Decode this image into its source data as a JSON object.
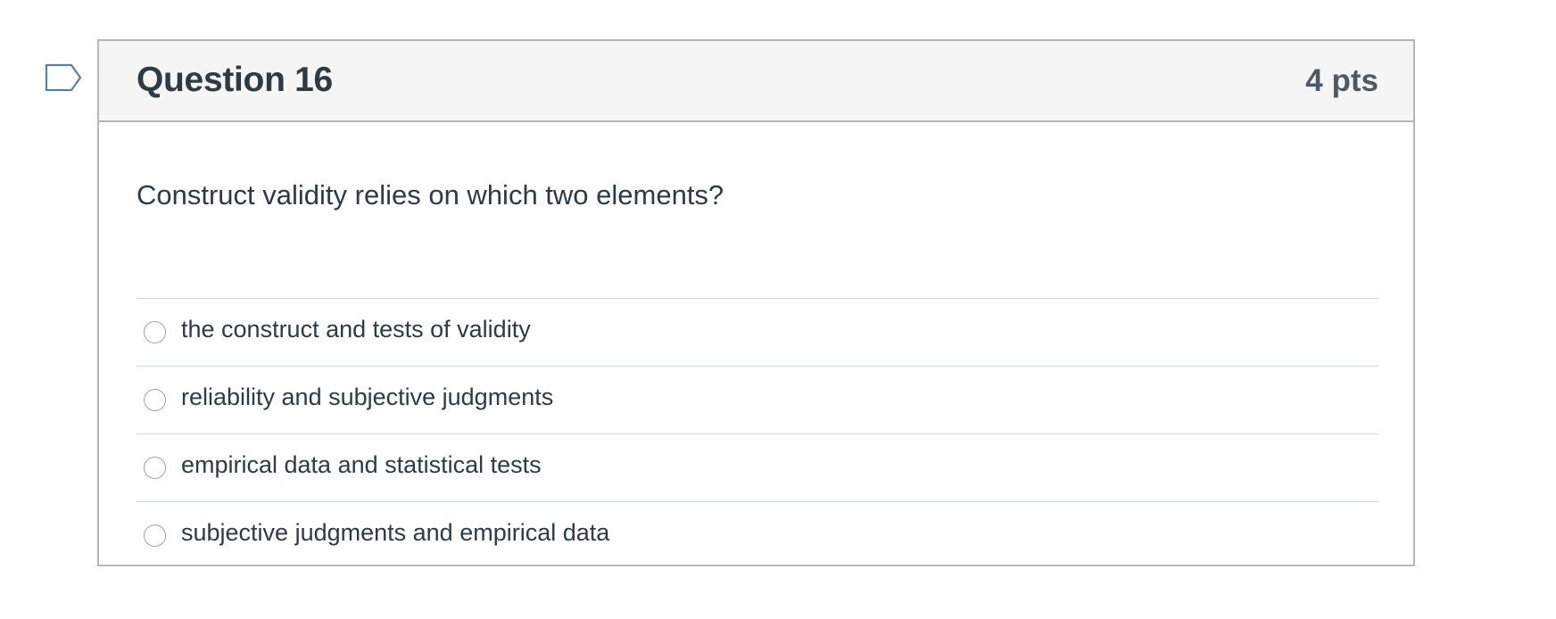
{
  "flag": {
    "icon": "bookmark-flag-icon",
    "color": "#5d7f99"
  },
  "question": {
    "title": "Question 16",
    "points": "4 pts",
    "text": "Construct validity relies on which two elements?",
    "answers": [
      {
        "label": "the construct and tests of validity",
        "selected": false
      },
      {
        "label": "reliability and subjective judgments",
        "selected": false
      },
      {
        "label": "empirical data and statistical tests",
        "selected": false
      },
      {
        "label": "subjective judgments and empirical data",
        "selected": false
      }
    ]
  },
  "colors": {
    "header_bg": "#f5f5f5",
    "border": "#b4b7ba",
    "text": "#2d3b45",
    "divider": "#d4d7d9"
  }
}
